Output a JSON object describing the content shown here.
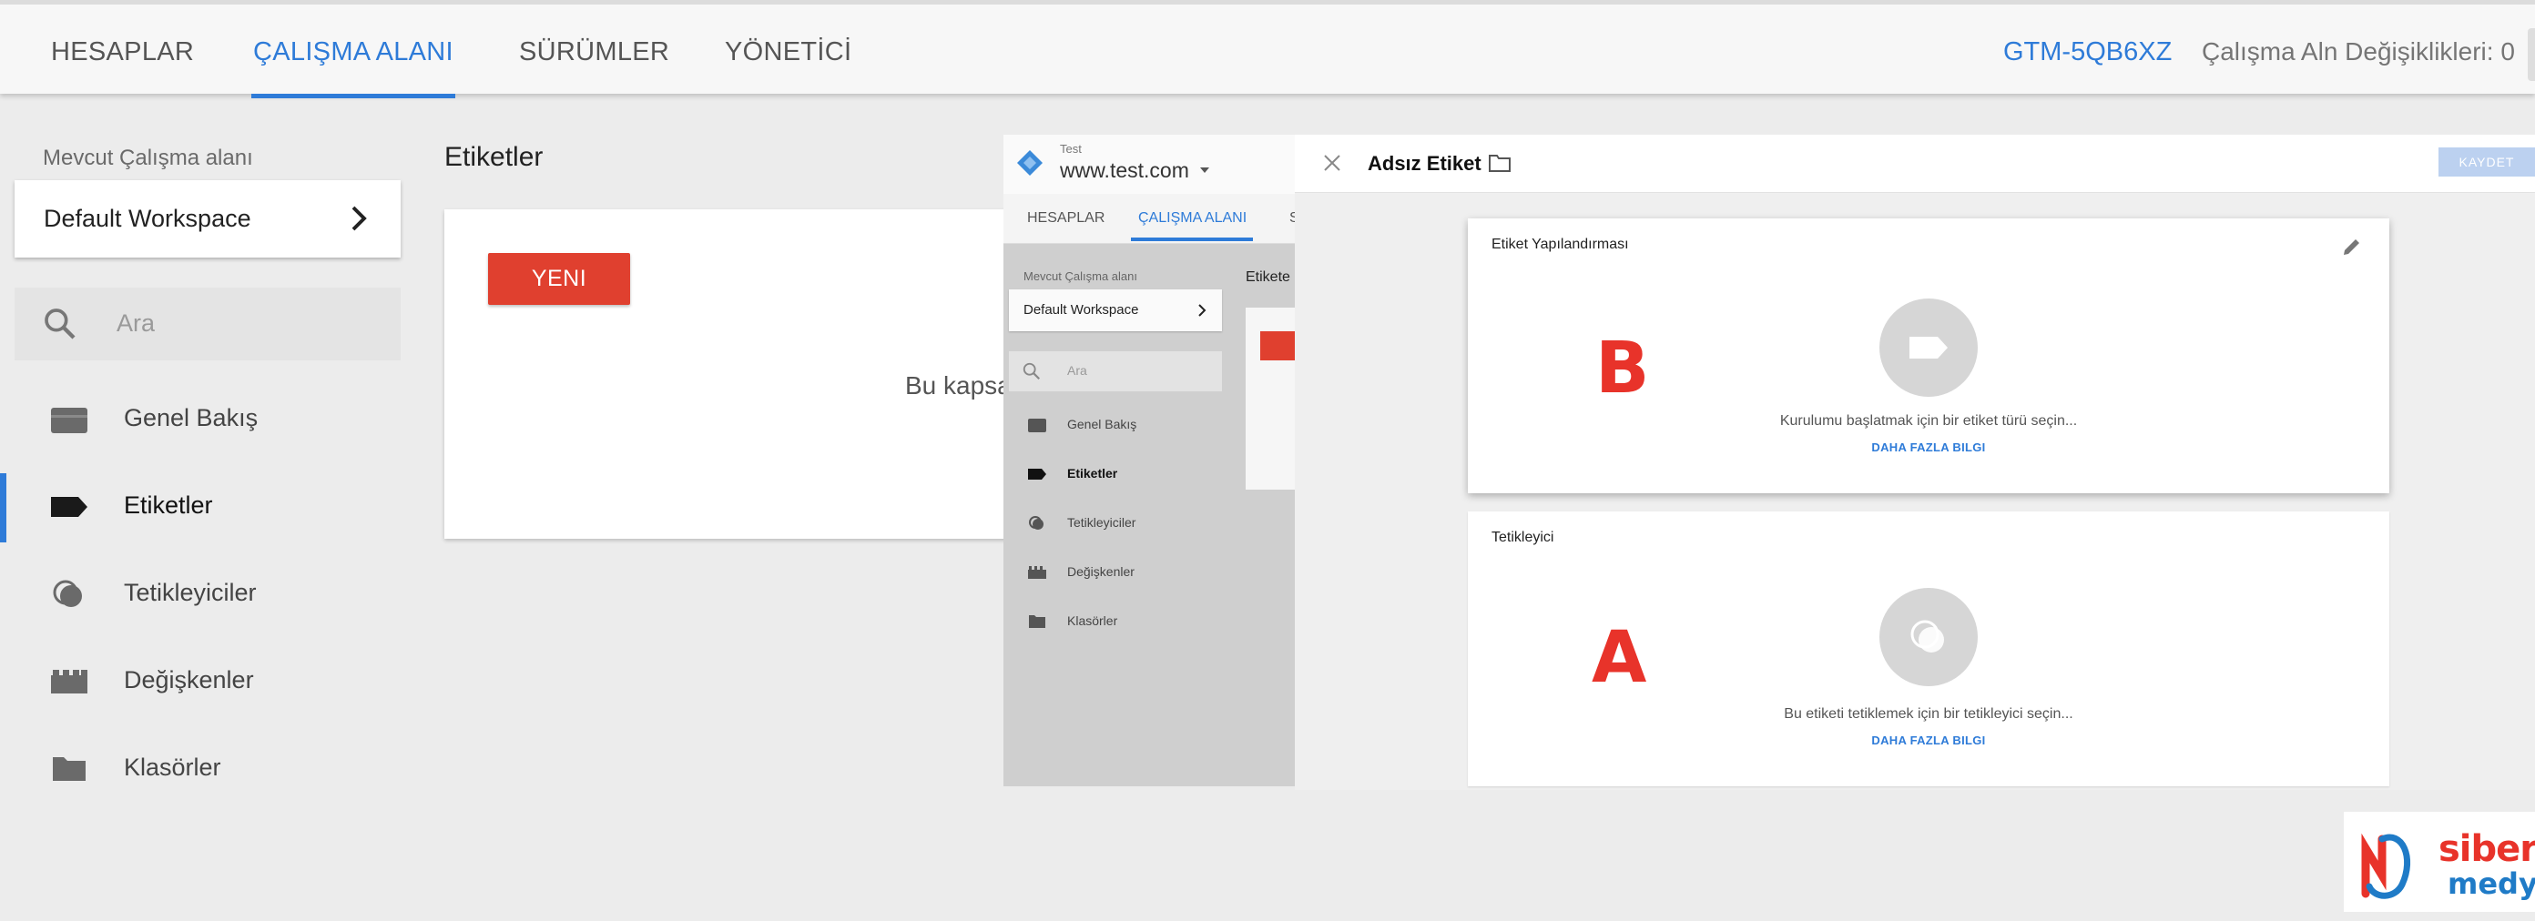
{
  "topnav": {
    "tabs": [
      {
        "label": "HESAPLAR"
      },
      {
        "label": "ÇALIŞMA ALANI"
      },
      {
        "label": "SÜRÜMLER"
      },
      {
        "label": "YÖNETİCİ"
      }
    ],
    "active_tab": "ÇALIŞMA ALANI",
    "container_id": "GTM-5QB6XZ",
    "changes": "Çalışma Aln Değişiklikleri: 0"
  },
  "sidebar": {
    "workspace_label": "Mevcut Çalışma alanı",
    "workspace_name": "Default Workspace",
    "search_placeholder": "Ara",
    "items": [
      {
        "label": "Genel Bakış",
        "icon": "overview-icon"
      },
      {
        "label": "Etiketler",
        "icon": "tag-icon",
        "active": true
      },
      {
        "label": "Tetikleyiciler",
        "icon": "trigger-icon"
      },
      {
        "label": "Değişkenler",
        "icon": "variables-icon"
      },
      {
        "label": "Klasörler",
        "icon": "folder-icon"
      }
    ]
  },
  "main": {
    "title": "Etiketler",
    "new_button": "YENI",
    "empty_text": "Bu kapsa"
  },
  "mini": {
    "account": "Test",
    "domain": "www.test.com",
    "tabs": [
      "HESAPLAR",
      "ÇALIŞMA ALANI",
      "S"
    ],
    "workspace_label": "Mevcut Çalışma alanı",
    "workspace_name": "Default Workspace",
    "search_placeholder": "Ara",
    "items": [
      "Genel Bakış",
      "Etiketler",
      "Tetikleyiciler",
      "Değişkenler",
      "Klasörler"
    ],
    "content_title": "Etikete"
  },
  "editor": {
    "title": "Adsız Etiket",
    "save_label": "KAYDET",
    "config": {
      "title": "Etiket Yapılandırması",
      "hint": "Kurulumu başlatmak için bir etiket türü seçin...",
      "link": "DAHA FAZLA BILGI",
      "letter": "B"
    },
    "trigger": {
      "title": "Tetikleyici",
      "hint": "Bu etiketi tetiklemek için bir tetikleyici seçin...",
      "link": "DAHA FAZLA BILGI",
      "letter": "A"
    }
  },
  "brand": {
    "line1": "siber",
    "line2": "medya"
  },
  "colors": {
    "accent": "#2e7bd8",
    "new_button": "#e0402f",
    "annotation": "#e8332a",
    "brand_blue": "#1f7bc7"
  }
}
